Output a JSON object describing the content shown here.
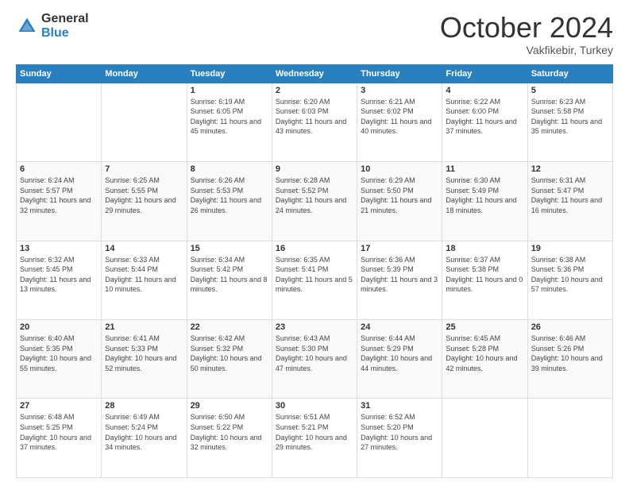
{
  "header": {
    "logo_general": "General",
    "logo_blue": "Blue",
    "month": "October 2024",
    "location": "Vakfikebir, Turkey"
  },
  "days_of_week": [
    "Sunday",
    "Monday",
    "Tuesday",
    "Wednesday",
    "Thursday",
    "Friday",
    "Saturday"
  ],
  "weeks": [
    [
      {
        "day": "",
        "info": ""
      },
      {
        "day": "",
        "info": ""
      },
      {
        "day": "1",
        "info": "Sunrise: 6:19 AM\nSunset: 6:05 PM\nDaylight: 11 hours and 45 minutes."
      },
      {
        "day": "2",
        "info": "Sunrise: 6:20 AM\nSunset: 6:03 PM\nDaylight: 11 hours and 43 minutes."
      },
      {
        "day": "3",
        "info": "Sunrise: 6:21 AM\nSunset: 6:02 PM\nDaylight: 11 hours and 40 minutes."
      },
      {
        "day": "4",
        "info": "Sunrise: 6:22 AM\nSunset: 6:00 PM\nDaylight: 11 hours and 37 minutes."
      },
      {
        "day": "5",
        "info": "Sunrise: 6:23 AM\nSunset: 5:58 PM\nDaylight: 11 hours and 35 minutes."
      }
    ],
    [
      {
        "day": "6",
        "info": "Sunrise: 6:24 AM\nSunset: 5:57 PM\nDaylight: 11 hours and 32 minutes."
      },
      {
        "day": "7",
        "info": "Sunrise: 6:25 AM\nSunset: 5:55 PM\nDaylight: 11 hours and 29 minutes."
      },
      {
        "day": "8",
        "info": "Sunrise: 6:26 AM\nSunset: 5:53 PM\nDaylight: 11 hours and 26 minutes."
      },
      {
        "day": "9",
        "info": "Sunrise: 6:28 AM\nSunset: 5:52 PM\nDaylight: 11 hours and 24 minutes."
      },
      {
        "day": "10",
        "info": "Sunrise: 6:29 AM\nSunset: 5:50 PM\nDaylight: 11 hours and 21 minutes."
      },
      {
        "day": "11",
        "info": "Sunrise: 6:30 AM\nSunset: 5:49 PM\nDaylight: 11 hours and 18 minutes."
      },
      {
        "day": "12",
        "info": "Sunrise: 6:31 AM\nSunset: 5:47 PM\nDaylight: 11 hours and 16 minutes."
      }
    ],
    [
      {
        "day": "13",
        "info": "Sunrise: 6:32 AM\nSunset: 5:45 PM\nDaylight: 11 hours and 13 minutes."
      },
      {
        "day": "14",
        "info": "Sunrise: 6:33 AM\nSunset: 5:44 PM\nDaylight: 11 hours and 10 minutes."
      },
      {
        "day": "15",
        "info": "Sunrise: 6:34 AM\nSunset: 5:42 PM\nDaylight: 11 hours and 8 minutes."
      },
      {
        "day": "16",
        "info": "Sunrise: 6:35 AM\nSunset: 5:41 PM\nDaylight: 11 hours and 5 minutes."
      },
      {
        "day": "17",
        "info": "Sunrise: 6:36 AM\nSunset: 5:39 PM\nDaylight: 11 hours and 3 minutes."
      },
      {
        "day": "18",
        "info": "Sunrise: 6:37 AM\nSunset: 5:38 PM\nDaylight: 11 hours and 0 minutes."
      },
      {
        "day": "19",
        "info": "Sunrise: 6:38 AM\nSunset: 5:36 PM\nDaylight: 10 hours and 57 minutes."
      }
    ],
    [
      {
        "day": "20",
        "info": "Sunrise: 6:40 AM\nSunset: 5:35 PM\nDaylight: 10 hours and 55 minutes."
      },
      {
        "day": "21",
        "info": "Sunrise: 6:41 AM\nSunset: 5:33 PM\nDaylight: 10 hours and 52 minutes."
      },
      {
        "day": "22",
        "info": "Sunrise: 6:42 AM\nSunset: 5:32 PM\nDaylight: 10 hours and 50 minutes."
      },
      {
        "day": "23",
        "info": "Sunrise: 6:43 AM\nSunset: 5:30 PM\nDaylight: 10 hours and 47 minutes."
      },
      {
        "day": "24",
        "info": "Sunrise: 6:44 AM\nSunset: 5:29 PM\nDaylight: 10 hours and 44 minutes."
      },
      {
        "day": "25",
        "info": "Sunrise: 6:45 AM\nSunset: 5:28 PM\nDaylight: 10 hours and 42 minutes."
      },
      {
        "day": "26",
        "info": "Sunrise: 6:46 AM\nSunset: 5:26 PM\nDaylight: 10 hours and 39 minutes."
      }
    ],
    [
      {
        "day": "27",
        "info": "Sunrise: 6:48 AM\nSunset: 5:25 PM\nDaylight: 10 hours and 37 minutes."
      },
      {
        "day": "28",
        "info": "Sunrise: 6:49 AM\nSunset: 5:24 PM\nDaylight: 10 hours and 34 minutes."
      },
      {
        "day": "29",
        "info": "Sunrise: 6:50 AM\nSunset: 5:22 PM\nDaylight: 10 hours and 32 minutes."
      },
      {
        "day": "30",
        "info": "Sunrise: 6:51 AM\nSunset: 5:21 PM\nDaylight: 10 hours and 29 minutes."
      },
      {
        "day": "31",
        "info": "Sunrise: 6:52 AM\nSunset: 5:20 PM\nDaylight: 10 hours and 27 minutes."
      },
      {
        "day": "",
        "info": ""
      },
      {
        "day": "",
        "info": ""
      }
    ]
  ]
}
